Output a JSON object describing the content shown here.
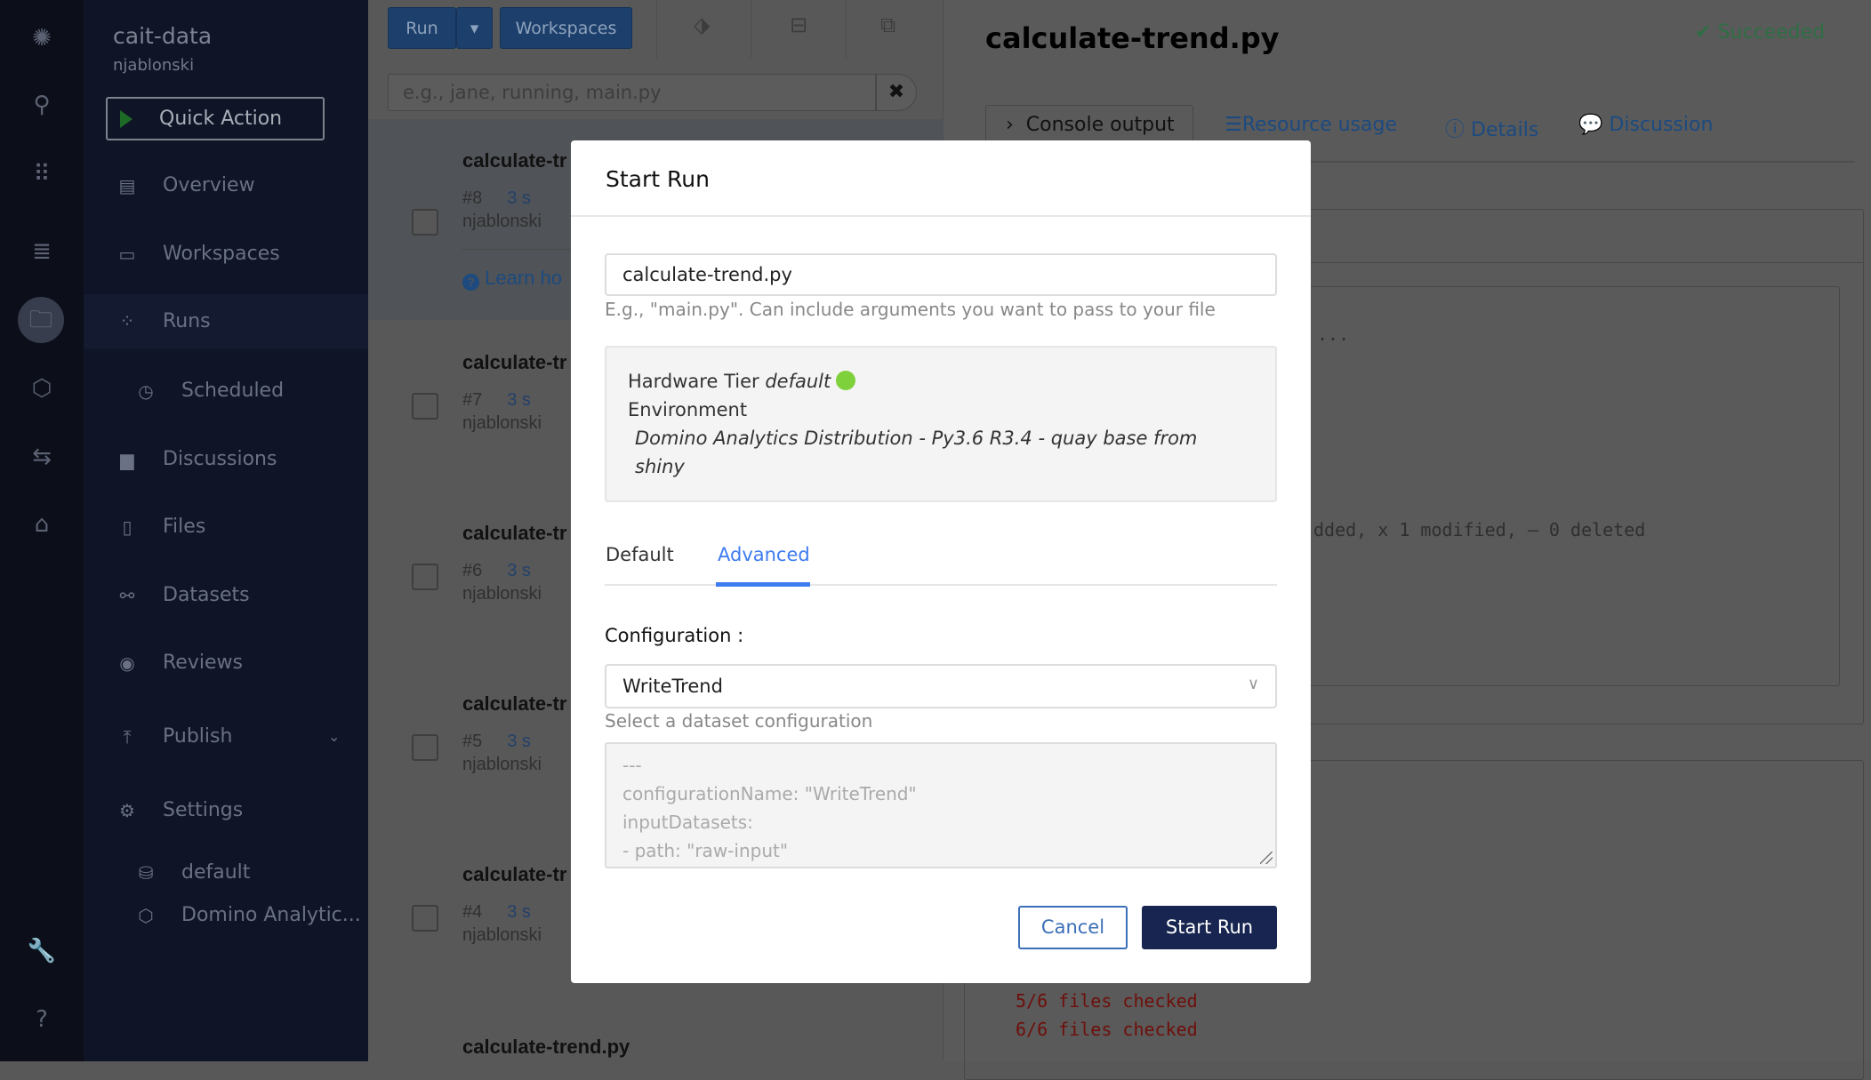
{
  "rail": {
    "icons": [
      "domino-logo-icon",
      "search-icon",
      "apps-grid-icon",
      "database-icon",
      "folder-icon",
      "cube-icon",
      "swap-arrows-icon",
      "tag-icon",
      "wrench-icon",
      "help-icon"
    ]
  },
  "sidebar": {
    "project": "cait-data",
    "owner": "njablonski",
    "quick_action": "Quick Action",
    "items": [
      {
        "label": "Overview",
        "icon": "overview-icon"
      },
      {
        "label": "Workspaces",
        "icon": "laptop-icon"
      },
      {
        "label": "Runs",
        "icon": "spinner-icon"
      },
      {
        "label": "Scheduled",
        "icon": "clock-icon"
      },
      {
        "label": "Discussions",
        "icon": "chat-icon"
      },
      {
        "label": "Files",
        "icon": "file-icon"
      },
      {
        "label": "Datasets",
        "icon": "link-icon"
      },
      {
        "label": "Reviews",
        "icon": "eye-icon"
      },
      {
        "label": "Publish",
        "icon": "upload-icon"
      },
      {
        "label": "Settings",
        "icon": "gear-icon"
      },
      {
        "label": "default",
        "icon": "hard-drive-icon"
      },
      {
        "label": "Domino Analytic...",
        "icon": "cube-icon"
      }
    ]
  },
  "runs_list": {
    "run_button": "Run",
    "workspaces_button": "Workspaces",
    "search_placeholder": "e.g., jane, running, main.py",
    "learn_link": "Learn ho",
    "rows": [
      {
        "title": "calculate-tr",
        "num": "#8",
        "duration": "3 s",
        "user": "njablonski"
      },
      {
        "title": "calculate-tr",
        "num": "#7",
        "duration": "3 s",
        "user": "njablonski"
      },
      {
        "title": "calculate-tr",
        "num": "#6",
        "duration": "3 s",
        "user": "njablonski"
      },
      {
        "title": "calculate-tr",
        "num": "#5",
        "duration": "3 s",
        "user": "njablonski"
      },
      {
        "title": "calculate-tr",
        "num": "#4",
        "duration": "3 s",
        "user": "njablonski"
      }
    ],
    "last_title": "calculate-trend.py"
  },
  "detail": {
    "title": "calculate-trend.py",
    "status": "Succeeded",
    "status_color": "#3aa25a",
    "tabs": [
      "Console output",
      "Resource usage",
      "Details",
      "Discussion"
    ],
    "console_line_1": "...",
    "console_line_2": "dded, x 1 modified, — 0 deleted",
    "console_line_3": "5/6 files checked",
    "console_line_4": "6/6 files checked"
  },
  "modal": {
    "title": "Start Run",
    "file_value": "calculate-trend.py",
    "file_help": "E.g., \"main.py\". Can include arguments you want to pass to your file",
    "hardware_label": "Hardware Tier",
    "hardware_value": "default",
    "environment_label": "Environment",
    "environment_value_1": "Domino Analytics Distribution - Py3.6 R3.4 - quay base from",
    "environment_value_2": "shiny",
    "tabs": {
      "default": "Default",
      "advanced": "Advanced",
      "active": "Advanced"
    },
    "config_label": "Configuration :",
    "config_value": "WriteTrend",
    "config_help": "Select a dataset configuration",
    "yaml": "---\nconfigurationName: \"WriteTrend\"\ninputDatasets:\n- path: \"raw-input\"",
    "cancel": "Cancel",
    "start": "Start Run",
    "accent": "#3d7bf0",
    "primary": "#172550"
  }
}
